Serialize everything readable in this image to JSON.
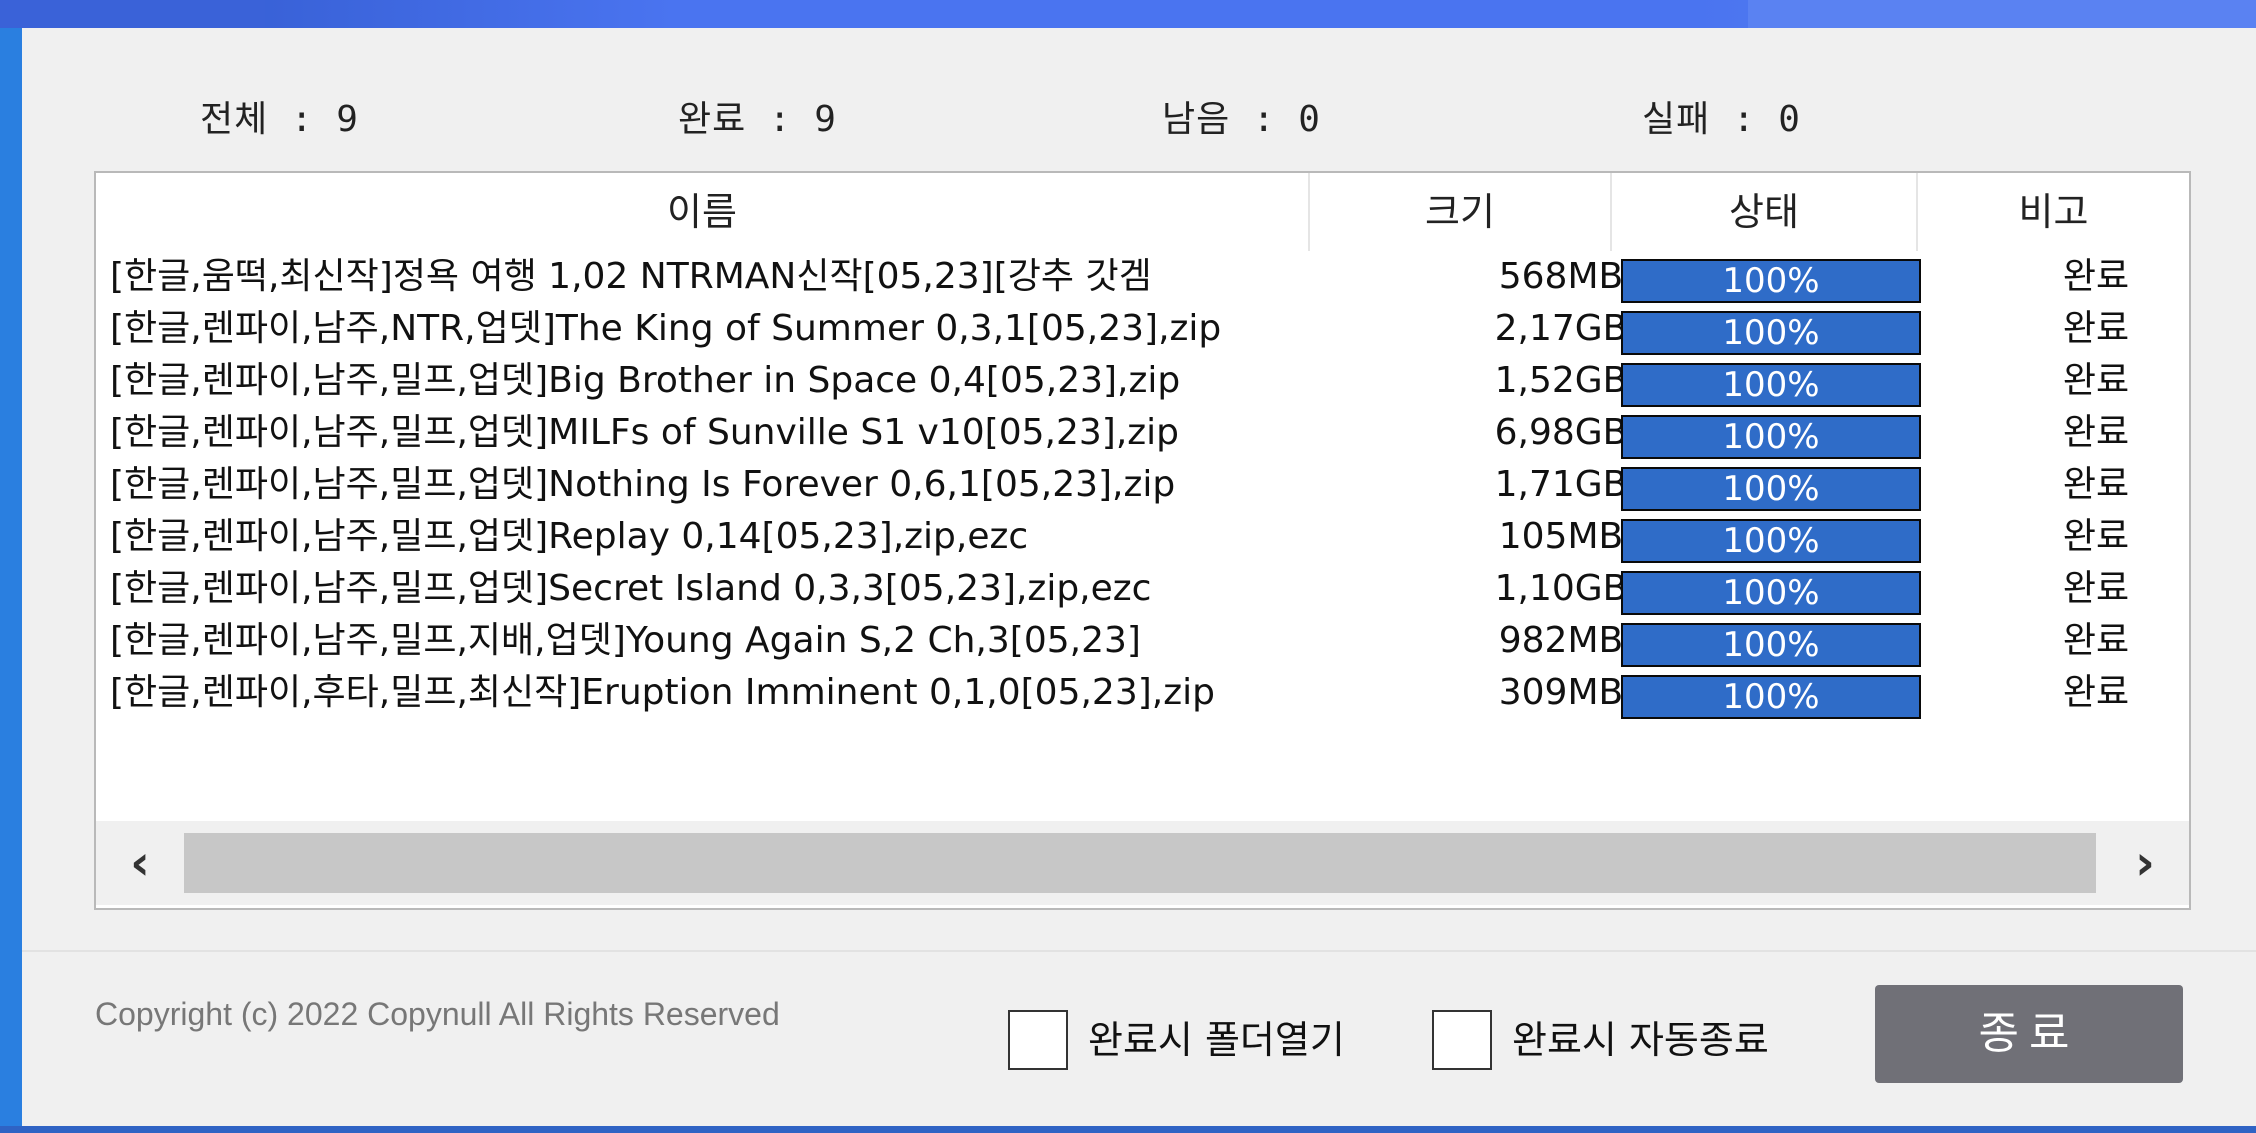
{
  "stats": {
    "total": "전체 : 9",
    "done": "완료 : 9",
    "remaining": "남음 : 0",
    "failed": "실패 : 0"
  },
  "columns": {
    "name": "이름",
    "size": "크기",
    "status": "상태",
    "note": "비고"
  },
  "rows": [
    {
      "name": "[한글,움떡,최신작]정욕 여행 1,02 NTRMAN신작[05,23][강추 갓겜",
      "size": "568MB",
      "status": "100%",
      "progress": 100,
      "note": "완료"
    },
    {
      "name": "[한글,렌파이,남주,NTR,업뎃]The King of Summer 0,3,1[05,23],zip",
      "size": "2,17GB",
      "status": "100%",
      "progress": 100,
      "note": "완료"
    },
    {
      "name": "[한글,렌파이,남주,밀프,업뎃]Big Brother in Space 0,4[05,23],zip",
      "size": "1,52GB",
      "status": "100%",
      "progress": 100,
      "note": "완료"
    },
    {
      "name": "[한글,렌파이,남주,밀프,업뎃]MILFs of Sunville S1 v10[05,23],zip",
      "size": "6,98GB",
      "status": "100%",
      "progress": 100,
      "note": "완료"
    },
    {
      "name": "[한글,렌파이,남주,밀프,업뎃]Nothing Is Forever 0,6,1[05,23],zip",
      "size": "1,71GB",
      "status": "100%",
      "progress": 100,
      "note": "완료"
    },
    {
      "name": "[한글,렌파이,남주,밀프,업뎃]Replay 0,14[05,23],zip,ezc",
      "size": "105MB",
      "status": "100%",
      "progress": 100,
      "note": "완료"
    },
    {
      "name": "[한글,렌파이,남주,밀프,업뎃]Secret Island 0,3,3[05,23],zip,ezc",
      "size": "1,10GB",
      "status": "100%",
      "progress": 100,
      "note": "완료"
    },
    {
      "name": "[한글,렌파이,남주,밀프,지배,업뎃]Young Again S,2  Ch,3[05,23]",
      "size": "982MB",
      "status": "100%",
      "progress": 100,
      "note": "완료"
    },
    {
      "name": "[한글,렌파이,후타,밀프,최신작]Eruption Imminent 0,1,0[05,23],zip",
      "size": "309MB",
      "status": "100%",
      "progress": 100,
      "note": "완료"
    }
  ],
  "scrollbar": {
    "left_arrow": "‹",
    "right_arrow": "›"
  },
  "footer": {
    "copyright": "Copyright (c) 2022 Copynull All Rights Reserved",
    "open_folder_label": "완료시 폴더열기",
    "auto_exit_label": "완료시 자동종료",
    "exit_button": "종료"
  },
  "colors": {
    "progress_fill": "#2f6cc8",
    "title_bar": "#4a74f0",
    "exit_button": "#707077"
  }
}
